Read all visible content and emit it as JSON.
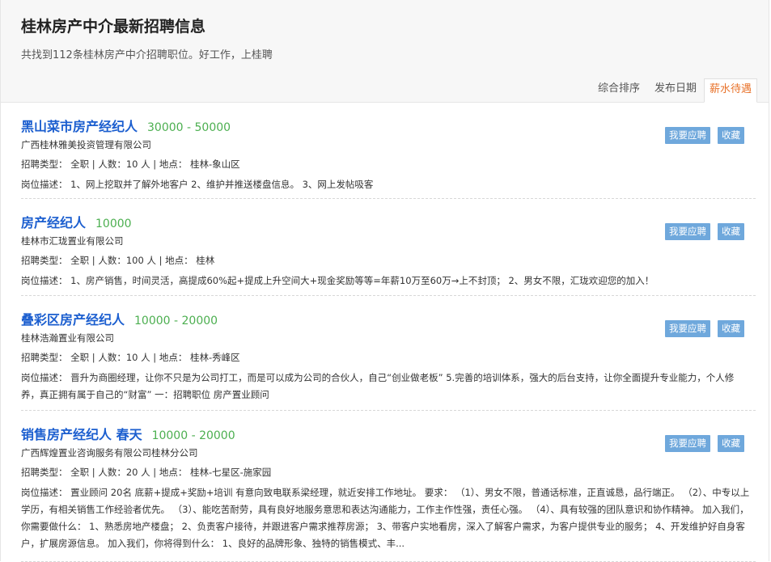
{
  "header": {
    "title": "桂林房产中介最新招聘信息",
    "subtitle": "共找到112条桂林房产中介招聘职位。好工作，上桂聘",
    "sort_tabs": [
      "综合排序",
      "发布日期",
      "薪水待遇"
    ]
  },
  "buttons": {
    "apply": "我要应聘",
    "favorite": "收藏"
  },
  "jobs": [
    {
      "title": "黑山菜市房产经纪人",
      "salary": "30000 - 50000",
      "company": "广西桂林雅美投资管理有限公司",
      "meta": "招聘类型： 全职 | 人数：10 人 | 地点： 桂林-象山区",
      "desc": "岗位描述： 1、网上挖取并了解外地客户 2、维护并推送楼盘信息。 3、网上发帖吸客"
    },
    {
      "title": "房产经纪人",
      "salary": "10000",
      "company": "桂林市汇珑置业有限公司",
      "meta": "招聘类型： 全职 | 人数：100 人 | 地点： 桂林",
      "desc": "岗位描述： 1、房产销售，时间灵活，高提成60%起+提成上升空间大+现金奖励等等=年薪10万至60万→上不封顶； 2、男女不限，汇珑欢迎您的加入！"
    },
    {
      "title": "叠彩区房产经纪人",
      "salary": "10000 - 20000",
      "company": "桂林浩瀚置业有限公司",
      "meta": "招聘类型： 全职 | 人数：10 人 | 地点： 桂林-秀峰区",
      "desc": "岗位描述： 晋升为商圈经理，让你不只是为公司打工，而是可以成为公司的合伙人，自己“创业做老板” 5.完善的培训体系，强大的后台支持，让你全面提升专业能力，个人修养，真正拥有属于自己的“财富” 一：招聘职位 房产置业顾问"
    },
    {
      "title": "销售房产经纪人 春天",
      "salary": "10000 - 20000",
      "company": "广西辉煌置业咨询服务有限公司桂林分公司",
      "meta": "招聘类型： 全职 | 人数：20 人 | 地点： 桂林-七星区-施家园",
      "desc": "岗位描述： 置业顾问 20名 底薪+提成+奖励+培训 有意向致电联系梁经理，就近安排工作地址。 要求： （1）、男女不限，普通话标准，正直诚恳，品行端正。 （2）、中专以上学历，有相关销售工作经验者优先。 （3）、能吃苦耐劳，具有良好地服务意思和表达沟通能力，工作主作性强，责任心强。 （4）、具有较强的团队意识和协作精神。 加入我们，你需要做什么： 1、熟悉房地产楼盘； 2、负责客户接待，并跟进客户需求推荐房源； 3、带客户实地看房，深入了解客户需求，为客户提供专业的服务； 4、开发维护好自身客户，扩展房源信息。 加入我们，你将得到什么： 1、良好的品牌形象、独特的销售模式、丰..."
    }
  ]
}
